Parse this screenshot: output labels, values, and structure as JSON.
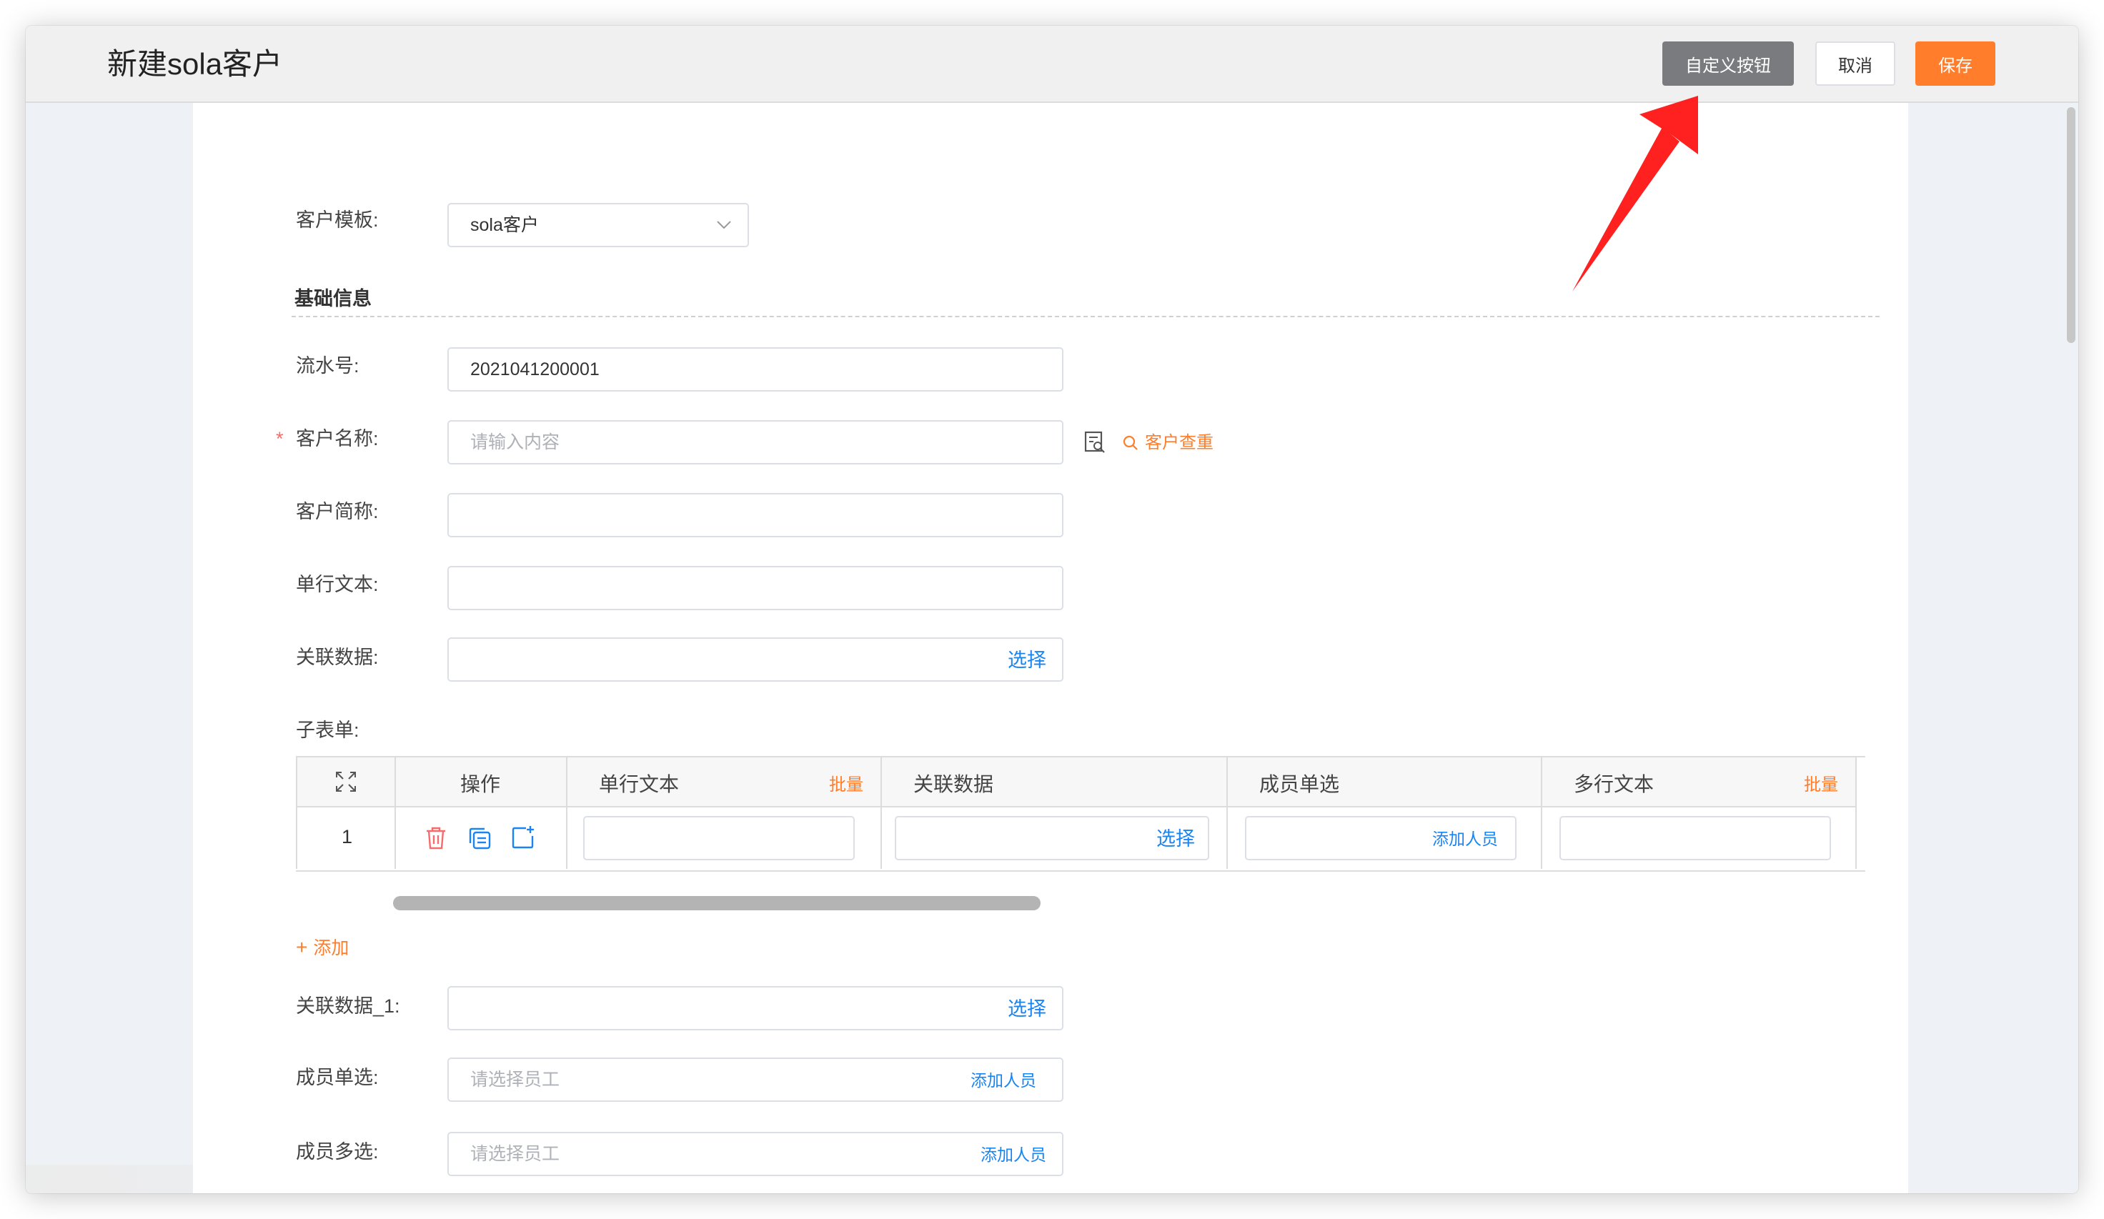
{
  "header": {
    "title": "新建sola客户",
    "buttons": {
      "custom": "自定义按钮",
      "cancel": "取消",
      "save": "保存"
    }
  },
  "form": {
    "template": {
      "label": "客户模板:",
      "value": "sola客户"
    },
    "section_basic": "基础信息",
    "serial": {
      "label": "流水号:",
      "value": "2021041200001"
    },
    "customer_name": {
      "label": "客户名称:",
      "required_mark": "*",
      "placeholder": "请输入内容",
      "dup_check": "客户查重"
    },
    "short_name": {
      "label": "客户简称:",
      "value": ""
    },
    "single_text": {
      "label": "单行文本:",
      "value": ""
    },
    "related_data": {
      "label": "关联数据:",
      "action": "选择"
    },
    "subform": {
      "label": "子表单:",
      "columns": {
        "ops": "操作",
        "single_text": "单行文本",
        "related_data": "关联数据",
        "member_single": "成员单选",
        "multi_text": "多行文本"
      },
      "batch_label": "批量",
      "rows": [
        {
          "index": "1",
          "related_action": "选择",
          "member_action": "添加人员"
        }
      ],
      "add_label": "添加"
    },
    "related_data_1": {
      "label": "关联数据_1:",
      "action": "选择"
    },
    "member_single": {
      "label": "成员单选:",
      "placeholder": "请选择员工",
      "action": "添加人员"
    },
    "member_multi": {
      "label": "成员多选:",
      "placeholder": "请选择员工",
      "action": "添加人员"
    }
  },
  "colors": {
    "accent_orange": "#ff7d2b",
    "link_blue": "#1a84f0",
    "danger_red": "#f56c6c",
    "annotation_arrow": "#ff2020"
  }
}
